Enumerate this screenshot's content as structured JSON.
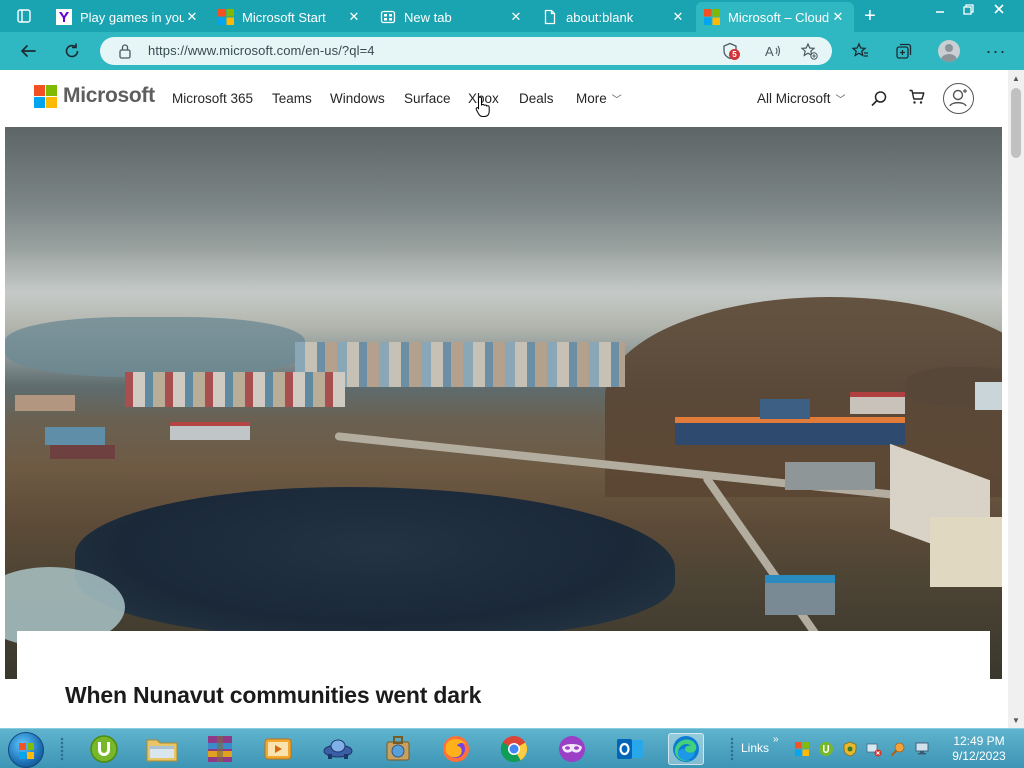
{
  "browser": {
    "tabs": [
      {
        "title": "Play games in your",
        "favicon": "yahoo-icon",
        "active": false
      },
      {
        "title": "Microsoft Start",
        "favicon": "microsoft-logo-icon",
        "active": false
      },
      {
        "title": "New tab",
        "favicon": "new-tab-icon",
        "active": false
      },
      {
        "title": "about:blank",
        "favicon": "page-icon",
        "active": false
      },
      {
        "title": "Microsoft – Cloud",
        "favicon": "microsoft-logo-icon",
        "active": true
      }
    ],
    "new_tab_label": "+",
    "url": "https://www.microsoft.com/en-us/?ql=4",
    "tracking_badge_count": "5",
    "accent_color": "#2fb8c2"
  },
  "site": {
    "logo_text": "Microsoft",
    "nav": [
      "Microsoft 365",
      "Teams",
      "Windows",
      "Surface",
      "Xbox",
      "Deals",
      "More"
    ],
    "all_microsoft": "All Microsoft",
    "logo_colors": [
      "#f25022",
      "#7fba00",
      "#00a4ef",
      "#ffb900"
    ]
  },
  "hero": {
    "card_title": "When Nunavut communities went dark"
  },
  "taskbar": {
    "links_label": "Links",
    "clock_time": "12:49 PM",
    "clock_date": "9/12/2023"
  }
}
